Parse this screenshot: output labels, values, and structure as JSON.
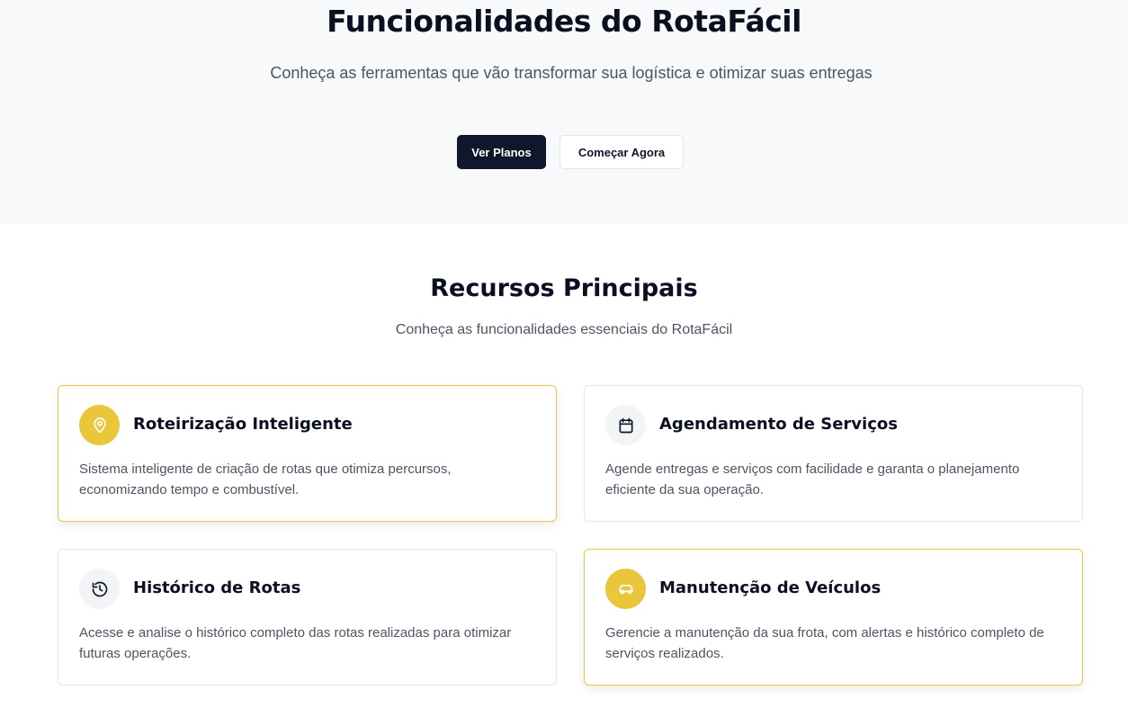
{
  "hero": {
    "title": "Funcionalidades do RotaFácil",
    "subtitle": "Conheça as ferramentas que vão transformar sua logística e otimizar suas entregas",
    "primary_button": "Ver Planos",
    "secondary_button": "Começar Agora"
  },
  "features": {
    "title": "Recursos Principais",
    "subtitle": "Conheça as funcionalidades essenciais do RotaFácil",
    "cards": [
      {
        "icon": "map-pin-icon",
        "title": "Roteirização Inteligente",
        "description": "Sistema inteligente de criação de rotas que otimiza percursos, economizando tempo e combustível."
      },
      {
        "icon": "calendar-icon",
        "title": "Agendamento de Serviços",
        "description": "Agende entregas e serviços com facilidade e garanta o planejamento eficiente da sua operação."
      },
      {
        "icon": "history-icon",
        "title": "Histórico de Rotas",
        "description": "Acesse e analise o histórico completo das rotas realizadas para otimizar futuras operações."
      },
      {
        "icon": "car-icon",
        "title": "Manutenção de Veículos",
        "description": "Gerencie a manutenção da sua frota, com alertas e histórico completo de serviços realizados."
      }
    ]
  },
  "colors": {
    "accent": "#e9c63a",
    "primary": "#0f172a",
    "hero_background": "#f8f9fb"
  }
}
